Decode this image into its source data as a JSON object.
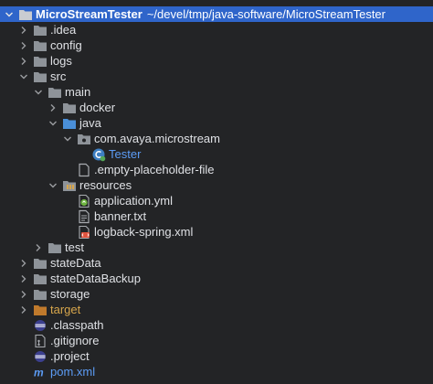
{
  "project": {
    "name": "MicroStreamTester",
    "path": "~/devel/tmp/java-software/MicroStreamTester"
  },
  "tree": {
    "idea": ".idea",
    "config": "config",
    "logs": "logs",
    "src": "src",
    "main": "main",
    "docker": "docker",
    "java": "java",
    "package": "com.avaya.microstream",
    "tester": "Tester",
    "empty_placeholder": ".empty-placeholder-file",
    "resources": "resources",
    "application_yml": "application.yml",
    "banner_txt": "banner.txt",
    "logback_xml": "logback-spring.xml",
    "test": "test",
    "stateData": "stateData",
    "stateDataBackup": "stateDataBackup",
    "storage": "storage",
    "target": "target",
    "classpath": ".classpath",
    "gitignore": ".gitignore",
    "project_file": ".project",
    "pom": "pom.xml"
  },
  "icons": {
    "expanded": "chevron-down-icon",
    "collapsed": "chevron-right-icon",
    "folder": "folder-icon",
    "source_folder": "source-folder-icon",
    "resources_folder": "resources-folder-icon",
    "excluded_folder": "excluded-folder-icon",
    "package": "package-icon",
    "class": "class-icon",
    "file": "file-icon",
    "spring_config": "spring-config-icon",
    "text_file": "text-file-icon",
    "xml_file": "xml-file-icon",
    "eclipse_file": "eclipse-file-icon",
    "git_file": "git-file-icon",
    "maven_file": "maven-file-icon"
  },
  "colors": {
    "background": "#232426",
    "selection": "#2f65ca",
    "folder": "#8e9399",
    "source_folder": "#4a8fd8",
    "excluded_folder": "#c07a2c",
    "excluded_text": "#d7a64c",
    "vcs_text": "#5c9cf5"
  }
}
